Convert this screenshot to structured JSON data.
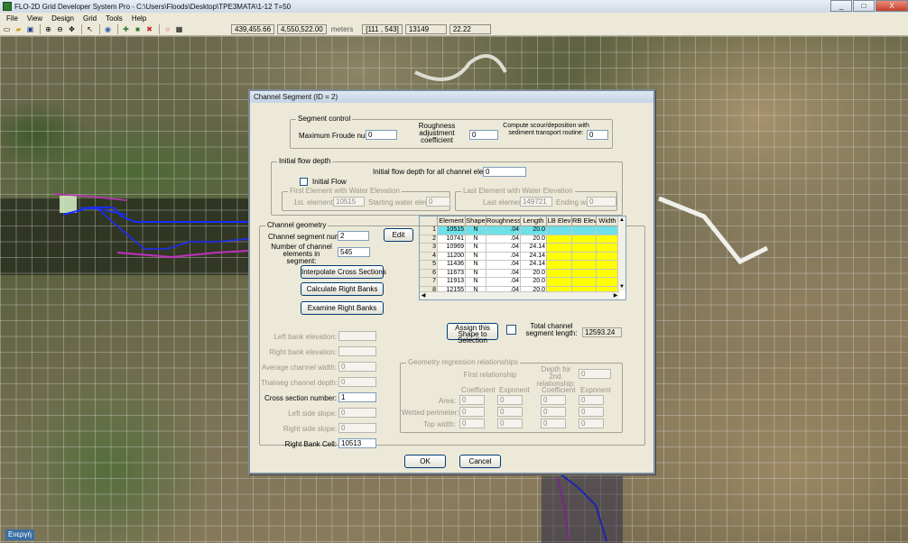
{
  "window": {
    "title": "FLO-2D Grid Developer System Pro - C:\\Users\\Floods\\Desktop\\TPE3MATA\\1-12 T=50",
    "controls": [
      "_",
      "□",
      "X"
    ]
  },
  "menu": [
    "File",
    "View",
    "Design",
    "Grid",
    "Tools",
    "Help"
  ],
  "toolbar": {
    "icons": [
      "new-icon",
      "open-icon",
      "save-icon",
      "zoom-in-icon",
      "zoom-out-icon",
      "pan-icon",
      "pointer-icon",
      "globe-icon",
      "grid-add-icon",
      "grid-green-icon",
      "delete-icon",
      "stop-icon",
      "grid-icon"
    ],
    "readouts": {
      "x": "439,455.66",
      "y": "4,550,522.00",
      "units": "meters",
      "cell_ij": "[111 , 543]",
      "cell_id": "13149",
      "elevation": "22.22"
    }
  },
  "status": {
    "label": "Ενεργή"
  },
  "dialog": {
    "title": "Channel Segment (ID = 2)",
    "segment_control": {
      "legend": "Segment control",
      "max_froude_label": "Maximum Froude number:",
      "max_froude_value": "0",
      "roughness_adj_label": "Roughness adjustment coefficient",
      "roughness_adj_value": "0",
      "scour_label": "Compute scour/deposition with sediment transport routine:",
      "scour_value": "0"
    },
    "initial_flow_depth": {
      "legend": "Initial flow depth",
      "depth_all_label": "Initial flow depth for all channel elements:",
      "depth_all_value": "0",
      "initial_flow_label": "Initial Flow",
      "first_legend": "First Element with Water Elevation",
      "first_element_label": "1st. element:",
      "first_element_value": "10515",
      "starting_label": "Starting water elev:",
      "starting_value": "0",
      "last_legend": "Last Element with Water Elevation",
      "last_element_label": "Last element:",
      "last_element_value": "149721",
      "ending_label": "Ending water elev:",
      "ending_value": "0"
    },
    "channel_geometry": {
      "legend": "Channel geometry",
      "segment_number_label": "Channel segment number:",
      "segment_number_value": "2",
      "edit_button": "Edit",
      "num_elements_label": "Number of channel elements in segment:",
      "num_elements_value": "545",
      "interpolate_button": "Interpolate Cross Sections",
      "calc_right_banks_button": "Calculate Right Banks",
      "examine_right_banks_button": "Examine Right Banks",
      "table": {
        "columns": [
          "Element",
          "Shape",
          "Roughness",
          "Length",
          "LB Elev",
          "RB Elev",
          "Width"
        ],
        "rows": [
          {
            "n": "1",
            "element": "10515",
            "shape": "N",
            "roughness": ".04",
            "length": "20.0"
          },
          {
            "n": "2",
            "element": "10741",
            "shape": "N",
            "roughness": ".04",
            "length": "20.0"
          },
          {
            "n": "3",
            "element": "10969",
            "shape": "N",
            "roughness": ".04",
            "length": "24.14"
          },
          {
            "n": "4",
            "element": "11200",
            "shape": "N",
            "roughness": ".04",
            "length": "24.14"
          },
          {
            "n": "5",
            "element": "11436",
            "shape": "N",
            "roughness": ".04",
            "length": "24.14"
          },
          {
            "n": "6",
            "element": "11673",
            "shape": "N",
            "roughness": ".04",
            "length": "20.0"
          },
          {
            "n": "7",
            "element": "11913",
            "shape": "N",
            "roughness": ".04",
            "length": "20.0"
          },
          {
            "n": "8",
            "element": "12155",
            "shape": "N",
            "roughness": ".04",
            "length": "20.0"
          }
        ]
      },
      "assign_shape_button": "Assign this Shape to Selection",
      "total_length_label": "Total channel segment length:",
      "total_length_value": "12593.24",
      "left_bank_elev_label": "Left bank elevation:",
      "left_bank_elev_value": "",
      "right_bank_elev_label": "Right bank elevation:",
      "right_bank_elev_value": "",
      "avg_width_label": "Average channel width:",
      "avg_width_value": "0",
      "thalweg_label": "Thalweg channel depth:",
      "thalweg_value": "0",
      "cross_section_label": "Cross section number:",
      "cross_section_value": "1",
      "left_slope_label": "Left side slope:",
      "left_slope_value": "0",
      "right_slope_label": "Right side slope:",
      "right_slope_value": "0",
      "right_bank_cell_label": "Right Bank Cell:",
      "right_bank_cell_value": "10513",
      "regression": {
        "legend": "Geometry regression relationships",
        "first_rel_label": "First relationship",
        "depth_second_label": "Depth for 2nd. relationship:",
        "depth_second_value": "0",
        "coef_label": "Coefficient",
        "exp_label": "Exponent",
        "row_labels": [
          "Area:",
          "Wetted perimeter:",
          "Top width:"
        ],
        "values": [
          [
            "0",
            "0",
            "0",
            "0"
          ],
          [
            "0",
            "0",
            "0",
            "0"
          ],
          [
            "0",
            "0",
            "0",
            "0"
          ]
        ]
      }
    },
    "ok_button": "OK",
    "cancel_button": "Cancel"
  }
}
